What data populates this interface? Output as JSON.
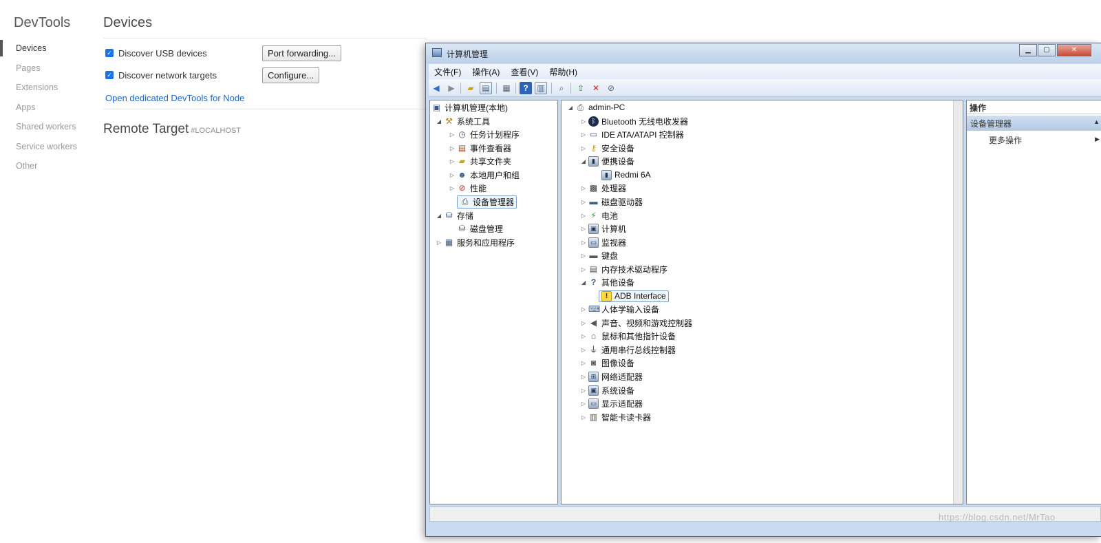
{
  "devtools": {
    "brand": "DevTools",
    "nav": [
      "Devices",
      "Pages",
      "Extensions",
      "Apps",
      "Shared workers",
      "Service workers",
      "Other"
    ],
    "active_nav": "Devices",
    "title": "Devices",
    "discover_usb_label": "Discover USB devices",
    "discover_usb_checked": true,
    "discover_network_label": "Discover network targets",
    "discover_network_checked": true,
    "port_forwarding_button": "Port forwarding...",
    "configure_button": "Configure...",
    "node_link": "Open dedicated DevTools for Node",
    "remote_target_title": "Remote Target",
    "remote_target_host": "#LOCALHOST"
  },
  "window": {
    "title": "计算机管理",
    "menu": [
      "文件(F)",
      "操作(A)",
      "查看(V)",
      "帮助(H)"
    ],
    "toolbar_icons": [
      "back-arrow-icon",
      "forward-arrow-icon",
      "up-folder-icon",
      "show-hide-tree-icon",
      "properties-icon",
      "help-icon",
      "show-hide-action-icon",
      "scan-hardware-icon",
      "update-driver-icon",
      "uninstall-icon",
      "disable-icon"
    ],
    "left_tree": {
      "root": "计算机管理(本地)",
      "system_tools": "系统工具",
      "system_children": [
        "任务计划程序",
        "事件查看器",
        "共享文件夹",
        "本地用户和组",
        "性能",
        "设备管理器"
      ],
      "storage": "存储",
      "storage_children": [
        "磁盘管理"
      ],
      "services": "服务和应用程序",
      "selected": "设备管理器"
    },
    "device_tree": {
      "root": "admin-PC",
      "categories": [
        {
          "label": "Bluetooth 无线电收发器",
          "expanded": false
        },
        {
          "label": "IDE ATA/ATAPI 控制器",
          "expanded": false
        },
        {
          "label": "安全设备",
          "expanded": false
        },
        {
          "label": "便携设备",
          "expanded": true,
          "children": [
            "Redmi 6A"
          ]
        },
        {
          "label": "处理器",
          "expanded": false
        },
        {
          "label": "磁盘驱动器",
          "expanded": false
        },
        {
          "label": "电池",
          "expanded": false
        },
        {
          "label": "计算机",
          "expanded": false
        },
        {
          "label": "监视器",
          "expanded": false
        },
        {
          "label": "键盘",
          "expanded": false
        },
        {
          "label": "内存技术驱动程序",
          "expanded": false
        },
        {
          "label": "其他设备",
          "expanded": true,
          "children": [
            "ADB Interface"
          ]
        },
        {
          "label": "人体学输入设备",
          "expanded": false
        },
        {
          "label": "声音、视频和游戏控制器",
          "expanded": false
        },
        {
          "label": "鼠标和其他指针设备",
          "expanded": false
        },
        {
          "label": "通用串行总线控制器",
          "expanded": false
        },
        {
          "label": "图像设备",
          "expanded": false
        },
        {
          "label": "网络适配器",
          "expanded": false
        },
        {
          "label": "系统设备",
          "expanded": false
        },
        {
          "label": "显示适配器",
          "expanded": false
        },
        {
          "label": "智能卡读卡器",
          "expanded": false
        }
      ],
      "selected": "ADB Interface",
      "warning_device": "ADB Interface"
    },
    "actions": {
      "header": "操作",
      "group": "设备管理器",
      "item": "更多操作"
    }
  },
  "watermark": "https://blog.csdn.net/MrTao",
  "colors": {
    "devtools_accent": "#1a73e8",
    "devtools_link": "#1967d2",
    "win_frame": "#c9daee",
    "selection_border": "#7da2ce"
  }
}
